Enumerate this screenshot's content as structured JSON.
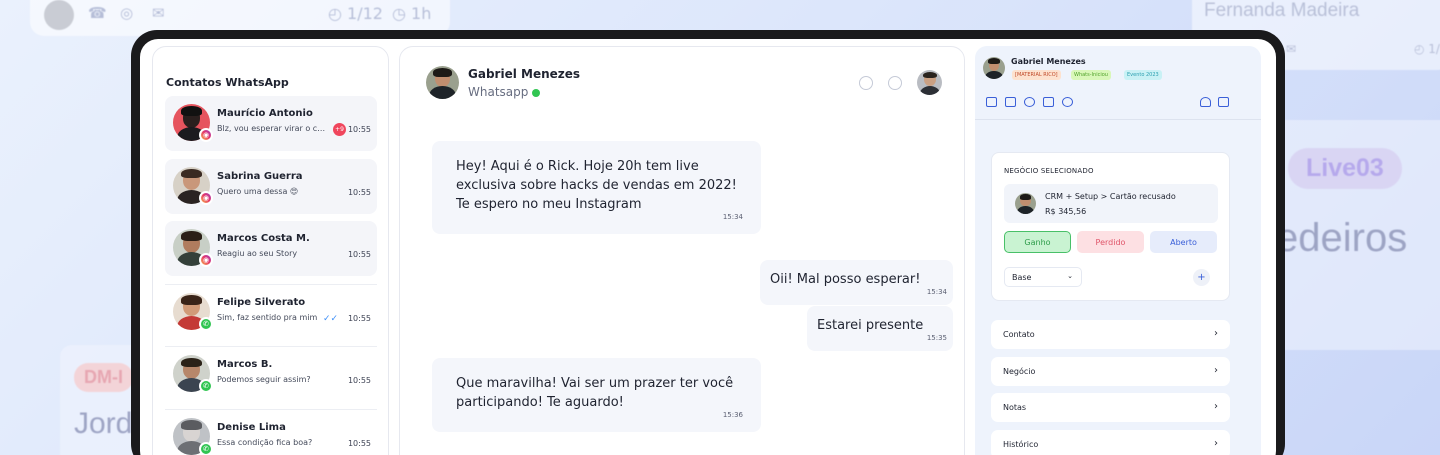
{
  "background": {
    "topbar": {
      "progress": "1/12",
      "duration": "1h"
    },
    "right_name": "Fernanda Madeira",
    "right_progress": "1/",
    "big_pill": "Live03",
    "big_word": "edeiros",
    "left_pill": "DM-I",
    "left_word": "Jord"
  },
  "contacts": {
    "title": "Contatos WhatsApp",
    "items": [
      {
        "name": "Maurício Antonio",
        "message": "Blz, vou esperar virar o car...",
        "time": "10:55",
        "channel": "instagram",
        "unread": "+9"
      },
      {
        "name": "Sabrina Guerra",
        "message": "Quero uma dessa 😍",
        "time": "10:55",
        "channel": "instagram"
      },
      {
        "name": "Marcos Costa M.",
        "message": "Reagiu ao seu Story",
        "time": "10:55",
        "channel": "instagram"
      },
      {
        "name": "Felipe Silverato",
        "message": "Sim, faz sentido pra mim",
        "time": "10:55",
        "channel": "whatsapp",
        "read": "✓✓"
      },
      {
        "name": "Marcos B.",
        "message": "Podemos seguir assim?",
        "time": "10:55",
        "channel": "whatsapp"
      },
      {
        "name": "Denise Lima",
        "message": "Essa condição fica boa?",
        "time": "10:55",
        "channel": "whatsapp"
      }
    ]
  },
  "chat": {
    "contact_name": "Gabriel Menezes",
    "channel": "Whatsapp",
    "messages": [
      {
        "direction": "in",
        "text": "Hey! Aqui é o Rick. Hoje 20h tem live exclusiva sobre hacks de vendas em 2022! Te espero no meu Instagram",
        "time": "15:34"
      },
      {
        "direction": "out",
        "text": "Oii! Mal posso esperar!",
        "time": "15:34"
      },
      {
        "direction": "out",
        "text": "Estarei presente",
        "time": "15:35"
      },
      {
        "direction": "in",
        "text": "Que maravilha! Vai ser um prazer ter você participando! Te aguardo!",
        "time": "15:36"
      }
    ]
  },
  "crm": {
    "name": "Gabriel Menezes",
    "tags": [
      "[MATERIAL RICO]",
      "Whats-Iniciou",
      "Evento 2023"
    ],
    "deal_section": "NEGÓCIO SELECIONADO",
    "deal_title": "CRM + Setup > Cartão recusado",
    "deal_value": "R$ 345,56",
    "status_buttons": [
      "Ganho",
      "Perdido",
      "Aberto"
    ],
    "pipeline": "Base",
    "plus": "+",
    "sections": [
      "Contato",
      "Negócio",
      "Notas",
      "Histórico"
    ]
  },
  "colors": {
    "accent": "#3a5fd8",
    "instagram": "#e6366b",
    "whatsapp": "#31c552",
    "won_bg": "#c9f3d2",
    "lost_bg": "#fde0e3",
    "open_bg": "#e6ecfb"
  }
}
